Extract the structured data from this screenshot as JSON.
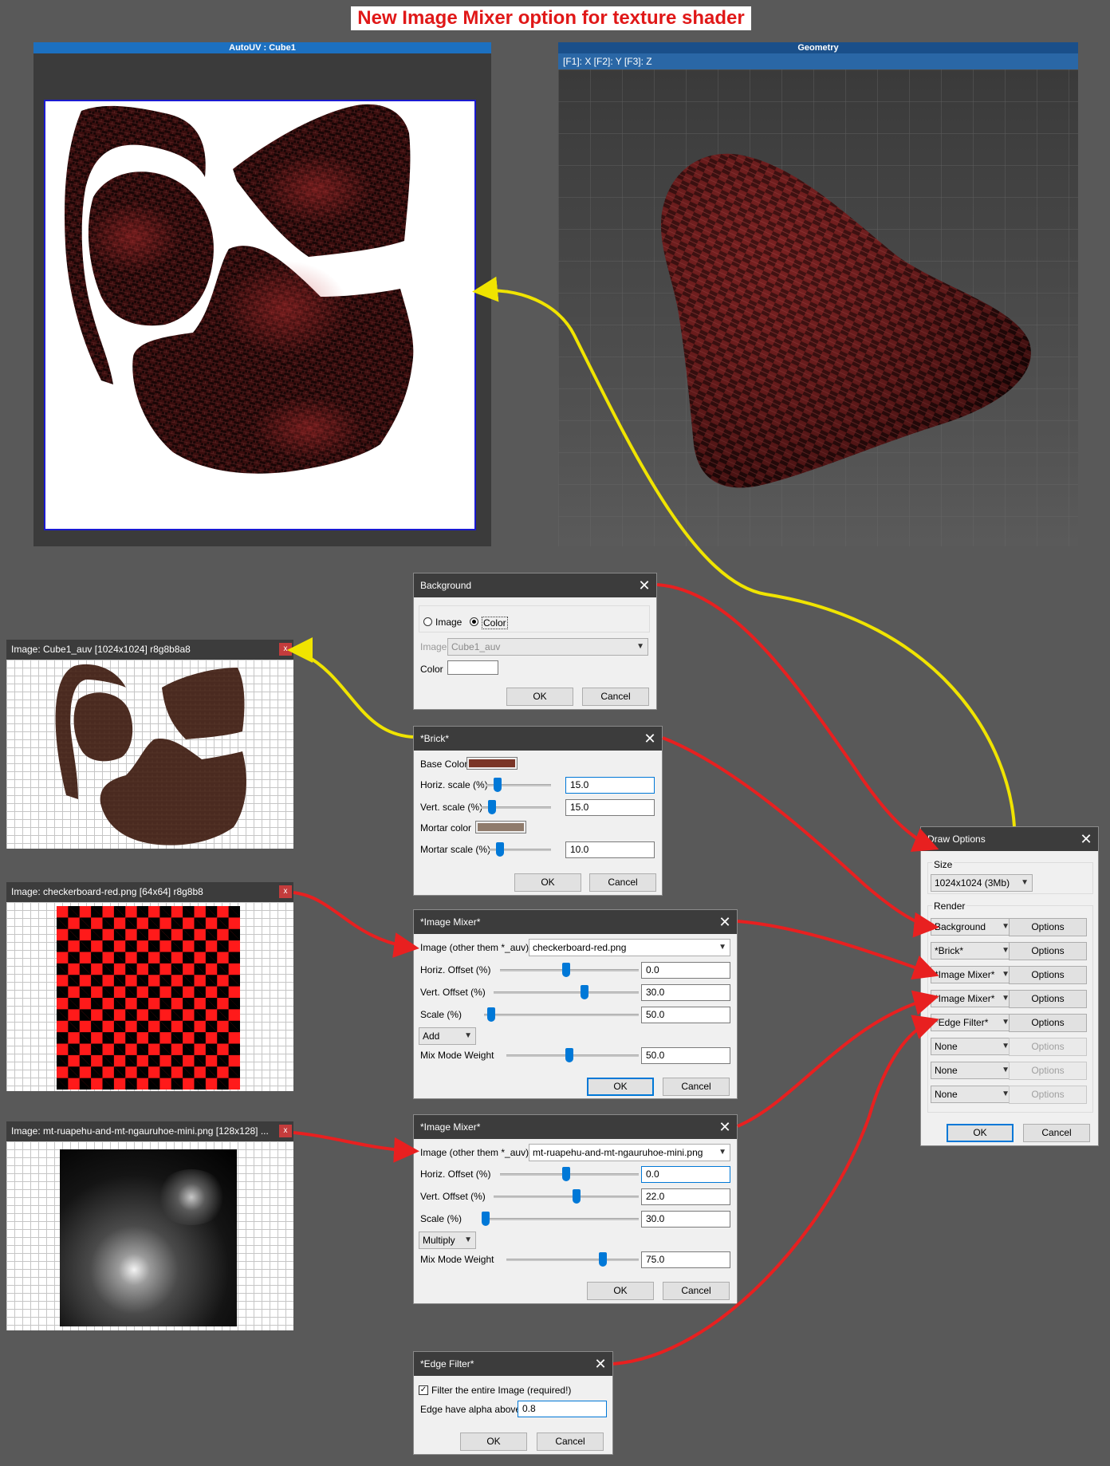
{
  "headline": "New Image Mixer  option for texture shader",
  "autouv": {
    "title": "AutoUV : Cube1"
  },
  "geometry": {
    "title": "Geometry",
    "axis_hint": "[F1]: X    [F2]: Y    [F3]: Z"
  },
  "image_windows": [
    {
      "title": "Image: Cube1_auv [1024x1024] r8g8b8a8",
      "close": "x"
    },
    {
      "title": "Image: checkerboard-red.png [64x64] r8g8b8",
      "close": "x"
    },
    {
      "title": "Image: mt-ruapehu-and-mt-ngauruhoe-mini.png [128x128] ...",
      "close": "x"
    }
  ],
  "background_dlg": {
    "title": "Background",
    "close": "✕",
    "radio_image": "Image",
    "radio_color": "Color",
    "image_label": "Image",
    "image_value": "Cube1_auv",
    "color_label": "Color",
    "ok": "OK",
    "cancel": "Cancel"
  },
  "brick_dlg": {
    "title": "*Brick*",
    "close": "✕",
    "base_color_label": "Base Color",
    "base_color": "#7a3527",
    "horiz_label": "Horiz. scale (%)",
    "horiz_value": "15.0",
    "vert_label": "Vert. scale (%)",
    "vert_value": "15.0",
    "mortar_color_label": "Mortar color",
    "mortar_color": "#8f7b6c",
    "mortar_scale_label": "Mortar scale (%)",
    "mortar_scale_value": "10.0",
    "ok": "OK",
    "cancel": "Cancel"
  },
  "mixer1_dlg": {
    "title": "*Image Mixer*",
    "close": "✕",
    "image_label": "Image (other them *_auv)",
    "image_value": "checkerboard-red.png",
    "hoff_label": "Horiz. Offset (%)",
    "hoff_value": "0.0",
    "voff_label": "Vert. Offset (%)",
    "voff_value": "30.0",
    "scale_label": "Scale (%)",
    "scale_value": "50.0",
    "mode_value": "Add",
    "weight_label": "Mix Mode Weight",
    "weight_value": "50.0",
    "ok": "OK",
    "cancel": "Cancel"
  },
  "mixer2_dlg": {
    "title": "*Image Mixer*",
    "close": "✕",
    "image_label": "Image (other them *_auv)",
    "image_value": "mt-ruapehu-and-mt-ngauruhoe-mini.png",
    "hoff_label": "Horiz. Offset (%)",
    "hoff_value": "0.0",
    "voff_label": "Vert. Offset (%)",
    "voff_value": "22.0",
    "scale_label": "Scale (%)",
    "scale_value": "30.0",
    "mode_value": "Multiply",
    "weight_label": "Mix Mode Weight",
    "weight_value": "75.0",
    "ok": "OK",
    "cancel": "Cancel"
  },
  "edge_dlg": {
    "title": "*Edge Filter*",
    "close": "✕",
    "check_label": "Filter the entire Image (required!)",
    "alpha_label": "Edge have alpha above",
    "alpha_value": "0.8",
    "ok": "OK",
    "cancel": "Cancel"
  },
  "draw_dlg": {
    "title": "Draw Options",
    "close": "✕",
    "size_label": "Size",
    "size_value": "1024x1024 (3Mb)",
    "render_label": "Render",
    "rows": [
      {
        "value": "Background",
        "options": "Options"
      },
      {
        "value": "*Brick*",
        "options": "Options"
      },
      {
        "value": "*Image Mixer*",
        "options": "Options"
      },
      {
        "value": "*Image Mixer*",
        "options": "Options"
      },
      {
        "value": "*Edge Filter*",
        "options": "Options"
      },
      {
        "value": "None",
        "options": "Options"
      },
      {
        "value": "None",
        "options": "Options"
      },
      {
        "value": "None",
        "options": "Options"
      }
    ],
    "ok": "OK",
    "cancel": "Cancel"
  },
  "colors": {
    "accent": "#0078d7",
    "headline_red": "#e01818",
    "arrow_red": "#e82020",
    "arrow_yellow": "#f0e400"
  }
}
